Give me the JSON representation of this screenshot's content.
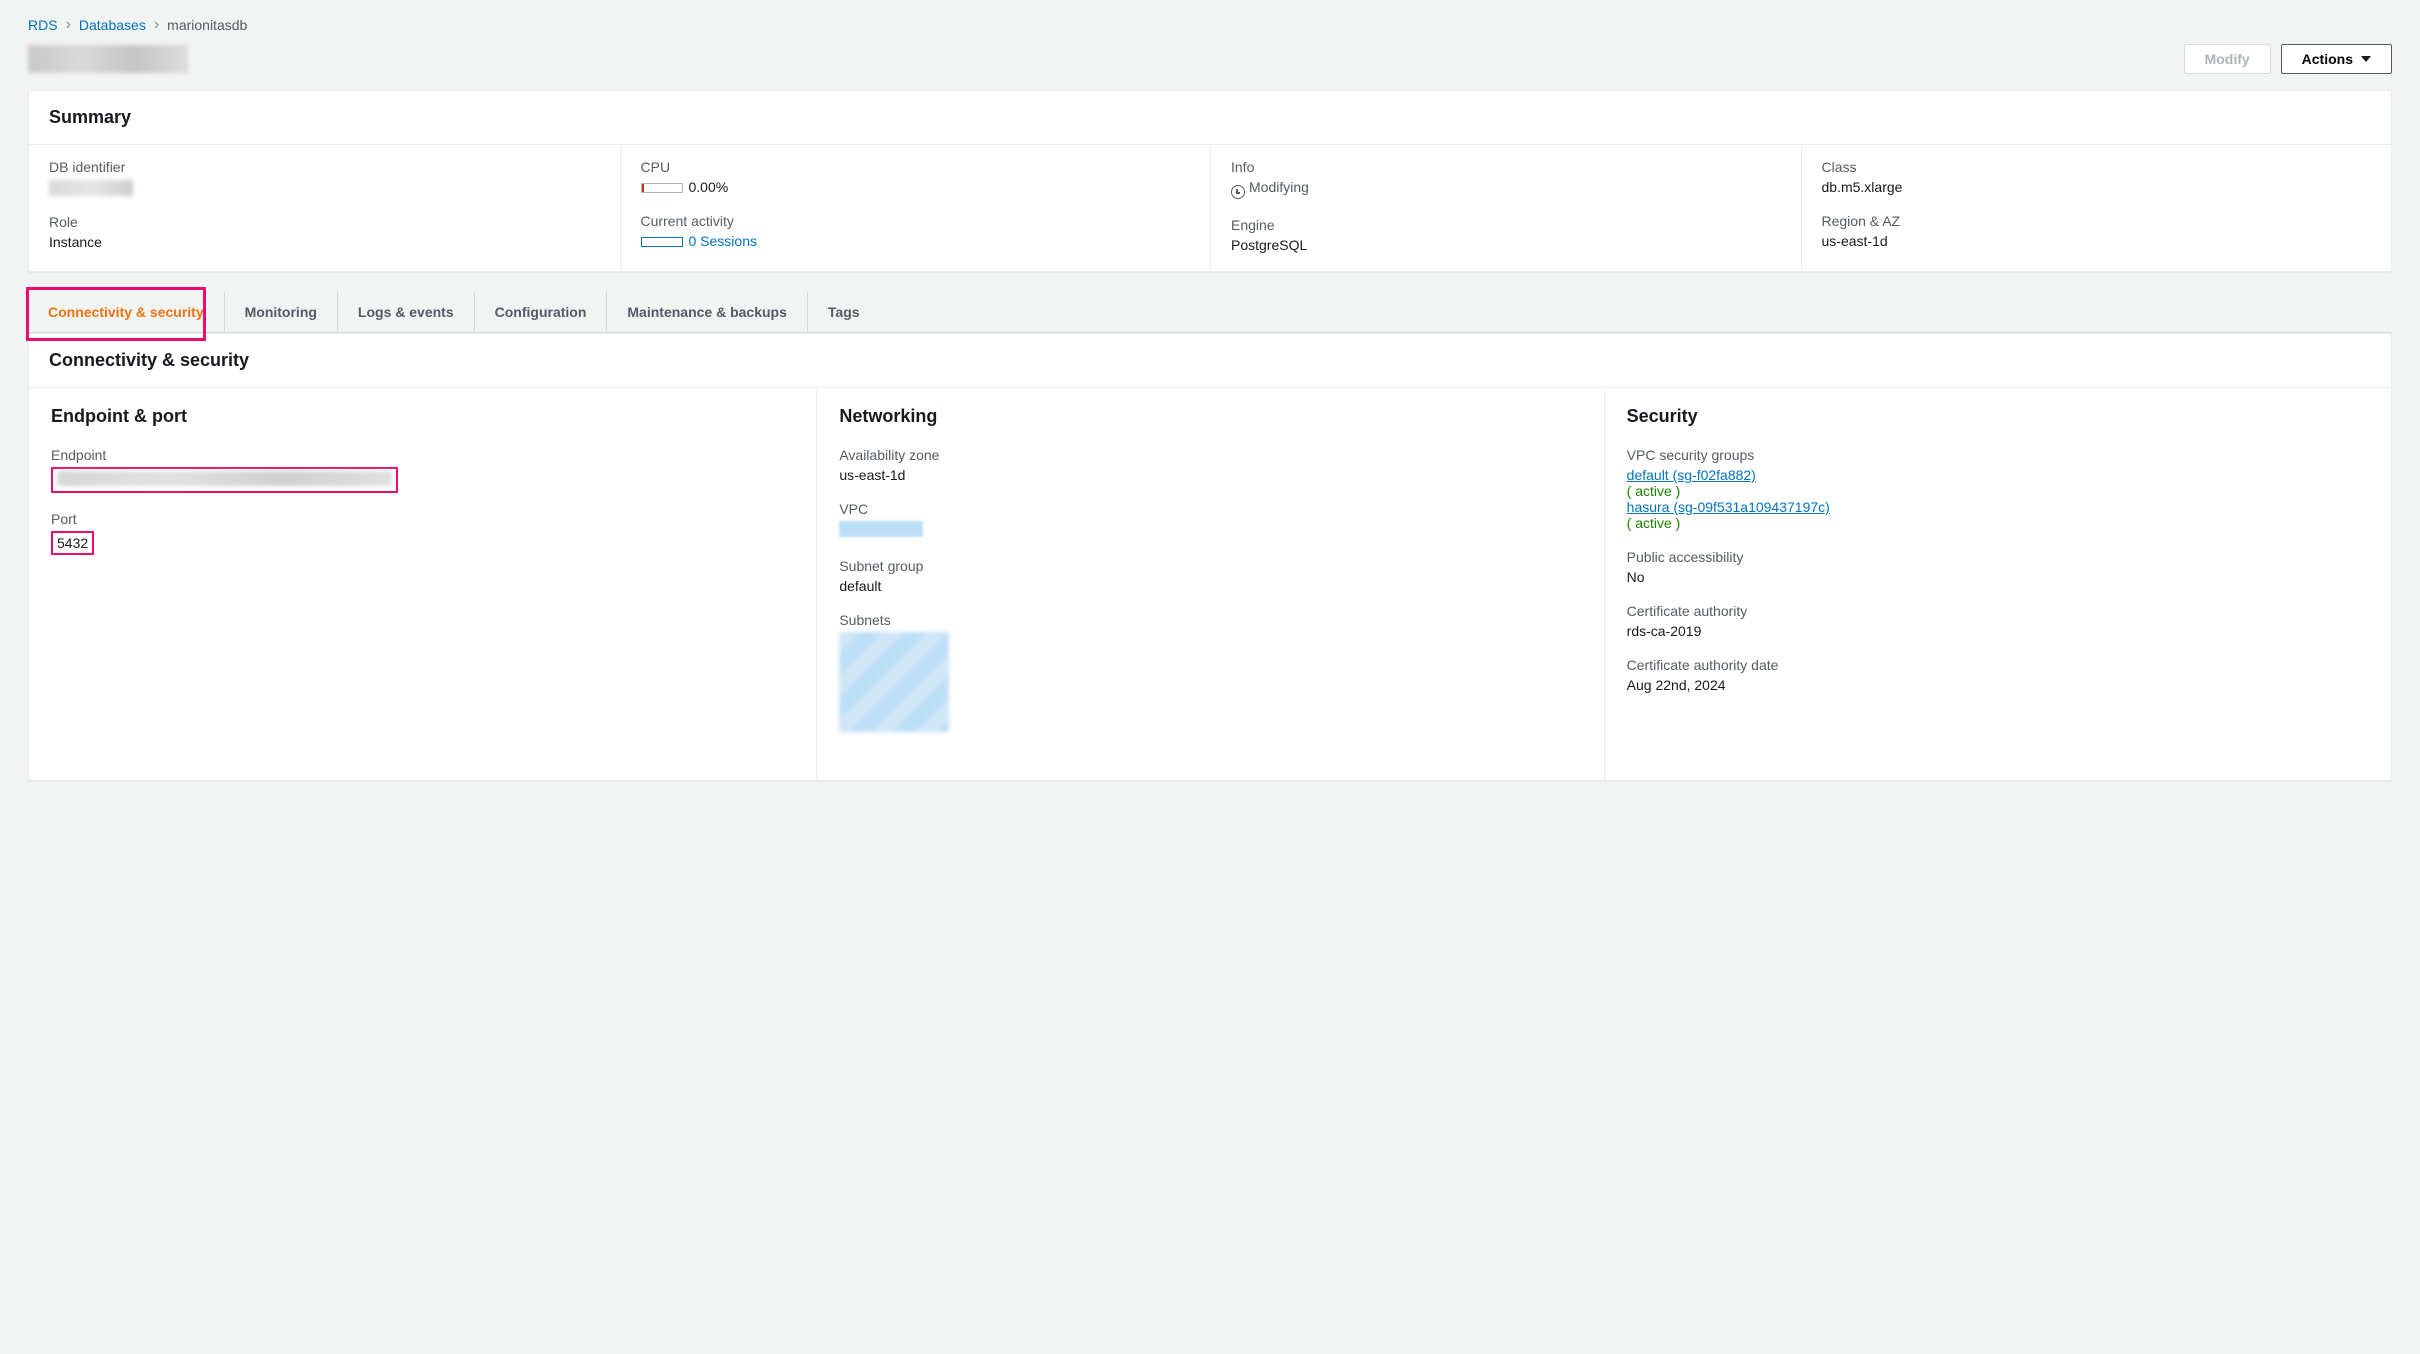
{
  "breadcrumb": {
    "rds": "RDS",
    "databases": "Databases",
    "current": "marionitasdb"
  },
  "buttons": {
    "modify": "Modify",
    "actions": "Actions"
  },
  "summary": {
    "title": "Summary",
    "db_identifier_lbl": "DB identifier",
    "cpu_lbl": "CPU",
    "cpu_val": "0.00%",
    "info_lbl": "Info",
    "info_val": "Modifying",
    "class_lbl": "Class",
    "class_val": "db.m5.xlarge",
    "role_lbl": "Role",
    "role_val": "Instance",
    "activity_lbl": "Current activity",
    "activity_val": "0 Sessions",
    "engine_lbl": "Engine",
    "engine_val": "PostgreSQL",
    "region_lbl": "Region & AZ",
    "region_val": "us-east-1d"
  },
  "tabs": {
    "connectivity": "Connectivity & security",
    "monitoring": "Monitoring",
    "logs": "Logs & events",
    "config": "Configuration",
    "maint": "Maintenance & backups",
    "tags": "Tags"
  },
  "conn": {
    "title": "Connectivity & security",
    "endpoint_title": "Endpoint & port",
    "endpoint_lbl": "Endpoint",
    "port_lbl": "Port",
    "port_val": "5432",
    "net_title": "Networking",
    "az_lbl": "Availability zone",
    "az_val": "us-east-1d",
    "vpc_lbl": "VPC",
    "sg_lbl": "Subnet group",
    "sg_val": "default",
    "subnets_lbl": "Subnets",
    "sec_title": "Security",
    "vsg_lbl": "VPC security groups",
    "vsg1": "default (sg-f02fa882)",
    "vsg1_status": "( active )",
    "vsg2": "hasura (sg-09f531a109437197c)",
    "vsg2_status": "( active )",
    "pub_lbl": "Public accessibility",
    "pub_val": "No",
    "ca_lbl": "Certificate authority",
    "ca_val": "rds-ca-2019",
    "cad_lbl": "Certificate authority date",
    "cad_val": "Aug 22nd, 2024"
  }
}
